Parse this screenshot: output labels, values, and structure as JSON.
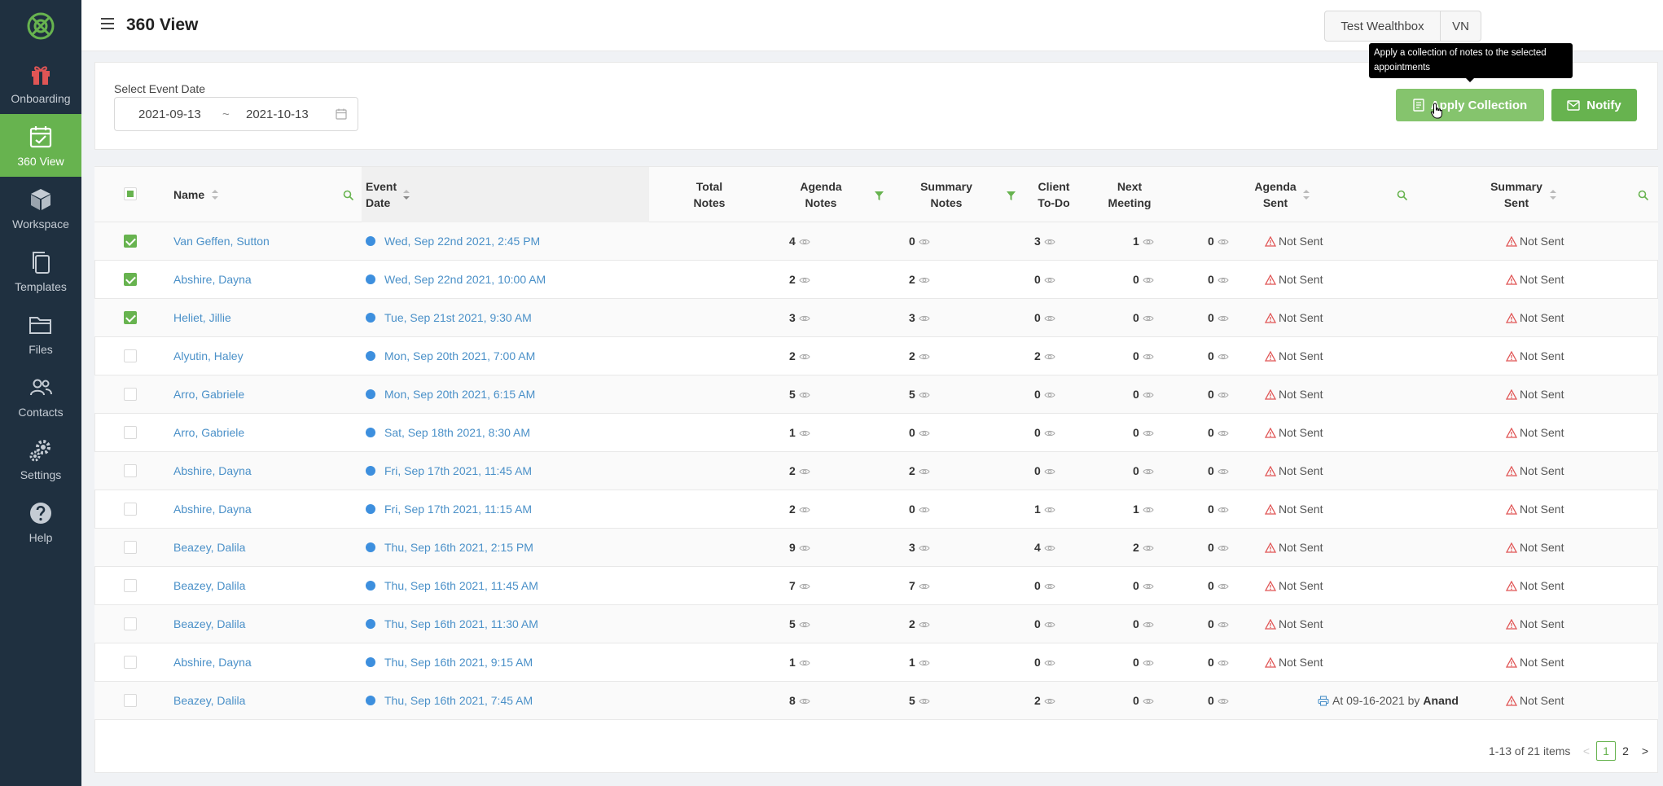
{
  "app": {
    "page_title": "360 View"
  },
  "colors": {
    "sidebar_bg": "#1f3040",
    "brand_green": "#67b34f",
    "link_blue": "#4a90c8",
    "warning_red": "#e05555"
  },
  "sidebar": {
    "items": [
      {
        "label": "Onboarding",
        "icon": "gift-icon"
      },
      {
        "label": "360 View",
        "icon": "calendar-icon",
        "active": true
      },
      {
        "label": "Workspace",
        "icon": "cube-icon"
      },
      {
        "label": "Templates",
        "icon": "copy-icon"
      },
      {
        "label": "Files",
        "icon": "folder-icon"
      },
      {
        "label": "Contacts",
        "icon": "users-icon"
      },
      {
        "label": "Settings",
        "icon": "gear-icon"
      },
      {
        "label": "Help",
        "icon": "help-icon"
      }
    ]
  },
  "header": {
    "integration_label": "Test Wealthbox",
    "user_initials": "VN"
  },
  "filter": {
    "label": "Select Event Date",
    "start_date": "2021-09-13",
    "separator": "~",
    "end_date": "2021-10-13"
  },
  "actions": {
    "apply_label": "Apply Collection",
    "apply_tooltip": "Apply a collection of notes to the selected appointments",
    "notify_label": "Notify"
  },
  "table": {
    "columns": {
      "name": "Name",
      "event_date_1": "Event",
      "event_date_2": "Date",
      "total_1": "Total",
      "total_2": "Notes",
      "agenda_1": "Agenda",
      "agenda_2": "Notes",
      "summary_1": "Summary",
      "summary_2": "Notes",
      "client_1": "Client",
      "client_2": "To-Do",
      "next_1": "Next",
      "next_2": "Meeting",
      "agenda_sent_1": "Agenda",
      "agenda_sent_2": "Sent",
      "summary_sent_1": "Summary",
      "summary_sent_2": "Sent"
    },
    "rows": [
      {
        "checked": true,
        "name": "Van Geffen, Sutton",
        "event": "Wed, Sep 22nd 2021, 2:45 PM",
        "total": "4",
        "agenda": "0",
        "summary": "3",
        "client": "1",
        "next": "0",
        "agenda_sent": "Not Sent",
        "summary_sent": "Not Sent"
      },
      {
        "checked": true,
        "name": "Abshire, Dayna",
        "event": "Wed, Sep 22nd 2021, 10:00 AM",
        "total": "2",
        "agenda": "2",
        "summary": "0",
        "client": "0",
        "next": "0",
        "agenda_sent": "Not Sent",
        "summary_sent": "Not Sent"
      },
      {
        "checked": true,
        "name": "Heliet, Jillie",
        "event": "Tue, Sep 21st 2021, 9:30 AM",
        "total": "3",
        "agenda": "3",
        "summary": "0",
        "client": "0",
        "next": "0",
        "agenda_sent": "Not Sent",
        "summary_sent": "Not Sent"
      },
      {
        "checked": false,
        "name": "Alyutin, Haley",
        "event": "Mon, Sep 20th 2021, 7:00 AM",
        "total": "2",
        "agenda": "2",
        "summary": "2",
        "client": "0",
        "next": "0",
        "agenda_sent": "Not Sent",
        "summary_sent": "Not Sent"
      },
      {
        "checked": false,
        "name": "Arro, Gabriele",
        "event": "Mon, Sep 20th 2021, 6:15 AM",
        "total": "5",
        "agenda": "5",
        "summary": "0",
        "client": "0",
        "next": "0",
        "agenda_sent": "Not Sent",
        "summary_sent": "Not Sent"
      },
      {
        "checked": false,
        "name": "Arro, Gabriele",
        "event": "Sat, Sep 18th 2021, 8:30 AM",
        "total": "1",
        "agenda": "0",
        "summary": "0",
        "client": "0",
        "next": "0",
        "agenda_sent": "Not Sent",
        "summary_sent": "Not Sent"
      },
      {
        "checked": false,
        "name": "Abshire, Dayna",
        "event": "Fri, Sep 17th 2021, 11:45 AM",
        "total": "2",
        "agenda": "2",
        "summary": "0",
        "client": "0",
        "next": "0",
        "agenda_sent": "Not Sent",
        "summary_sent": "Not Sent"
      },
      {
        "checked": false,
        "name": "Abshire, Dayna",
        "event": "Fri, Sep 17th 2021, 11:15 AM",
        "total": "2",
        "agenda": "0",
        "summary": "1",
        "client": "1",
        "next": "0",
        "agenda_sent": "Not Sent",
        "summary_sent": "Not Sent"
      },
      {
        "checked": false,
        "name": "Beazey, Dalila",
        "event": "Thu, Sep 16th 2021, 2:15 PM",
        "total": "9",
        "agenda": "3",
        "summary": "4",
        "client": "2",
        "next": "0",
        "agenda_sent": "Not Sent",
        "summary_sent": "Not Sent"
      },
      {
        "checked": false,
        "name": "Beazey, Dalila",
        "event": "Thu, Sep 16th 2021, 11:45 AM",
        "total": "7",
        "agenda": "7",
        "summary": "0",
        "client": "0",
        "next": "0",
        "agenda_sent": "Not Sent",
        "summary_sent": "Not Sent"
      },
      {
        "checked": false,
        "name": "Beazey, Dalila",
        "event": "Thu, Sep 16th 2021, 11:30 AM",
        "total": "5",
        "agenda": "2",
        "summary": "0",
        "client": "0",
        "next": "0",
        "agenda_sent": "Not Sent",
        "summary_sent": "Not Sent"
      },
      {
        "checked": false,
        "name": "Abshire, Dayna",
        "event": "Thu, Sep 16th 2021, 9:15 AM",
        "total": "1",
        "agenda": "1",
        "summary": "0",
        "client": "0",
        "next": "0",
        "agenda_sent": "Not Sent",
        "summary_sent": "Not Sent"
      },
      {
        "checked": false,
        "name": "Beazey, Dalila",
        "event": "Thu, Sep 16th 2021, 7:45 AM",
        "total": "8",
        "agenda": "5",
        "summary": "2",
        "client": "0",
        "next": "0",
        "agenda_sent_prefix": "At 09-16-2021 by",
        "agenda_sent_by": "Anand",
        "summary_sent": "Not Sent"
      }
    ]
  },
  "pagination": {
    "summary": "1-13 of 21 items",
    "prev": "<",
    "pages": [
      "1",
      "2"
    ],
    "current": "1",
    "next": ">"
  }
}
